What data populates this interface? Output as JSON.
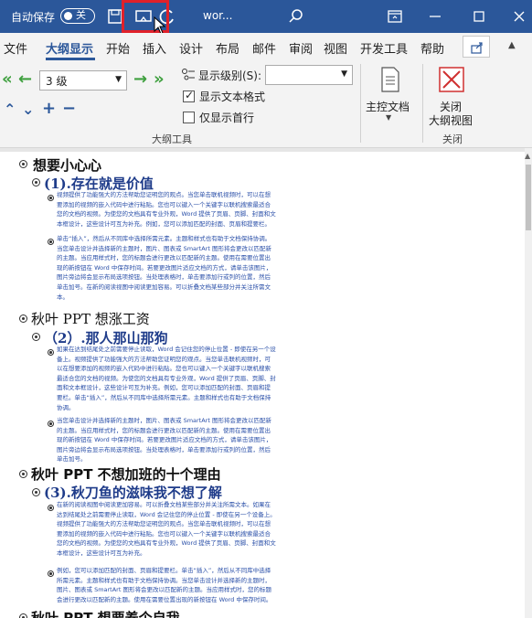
{
  "titlebar": {
    "autosave_label": "自动保存",
    "autosave_state": "关",
    "doc_title": "wor...",
    "icons": [
      "save-icon",
      "present-icon",
      "redo-icon",
      "search-icon",
      "ribbon-display-icon",
      "minimize-icon",
      "maximize-icon",
      "close-icon"
    ]
  },
  "tabs": [
    "文件",
    "大纲显示",
    "开始",
    "插入",
    "设计",
    "布局",
    "邮件",
    "审阅",
    "视图",
    "开发工具",
    "帮助"
  ],
  "active_tab": "大纲显示",
  "ribbon": {
    "level_value": "3 级",
    "show_level_label": "显示级别(S):",
    "show_level_value": "",
    "show_text_format_label": "显示文本格式",
    "show_text_format_checked": true,
    "first_line_only_label": "仅显示首行",
    "first_line_only_checked": false,
    "outline_tools_label": "大纲工具",
    "master_doc_label": "主控文档",
    "close_outline_label": "关闭\n大纲视图",
    "close_label": "关闭",
    "close_btn_line1": "关闭",
    "close_btn_line2": "大纲视图"
  },
  "document": {
    "h1_1": "想要小心心",
    "h2_1": "(1).存在就是价值",
    "p1": "视频提供了功能强大的方法帮助您证明您的观点。当您单击联机视频时，可以在想要添加的视频的嵌入代码中进行粘贴。您也可以键入一个关键字以联机搜索最适合您的文档的视频。为使您的文档具有专业外观，Word 提供了页眉、页脚、封面和文本框设计，这些设计可互为补充。例如，您可以添加匹配的封面、页眉和提要栏。",
    "p2": "单击“插入”，然后从不同库中选择所需元素。主题和样式也有助于文档保持协调。当您单击设计并选择新的主题时，图片、图表或 SmartArt 图形将会更改以匹配新的主题。当应用样式时，您的标题会进行更改以匹配新的主题。使用在需要位置出现的新按钮在 Word 中保存时间。若要更改图片适应文档的方式，请单击该图片，图片旁边将会显示布局选项按钮。当处理表格时，单击要添加行或列的位置，然后单击加号。在新的阅读视图中阅读更加容易。可以折叠文档某些部分并关注所需文本。",
    "h1_2": "秋叶 PPT 想涨工资",
    "h2_2": "（2）.那人那山那狗",
    "p3": "如果在达到结尾处之前需要停止读取，Word 会记住您的停止位置 - 即使在另一个设备上。视频提供了功能强大的方法帮助您证明您的观点。当您单击联机视频时，可以在想要添加的视频的嵌入代码中进行粘贴。您也可以键入一个关键字以联机搜索最适合您的文档的视频。为使您的文档具有专业外观，Word 提供了页眉、页脚、封面和文本框设计，这些设计可互为补充。例如，您可以添加匹配的封面、页眉和提要栏。单击“插入”，然后从不同库中选择所需元素。主题和样式也有助于文档保持协调。",
    "p4": "当您单击设计并选择新的主题时，图片、图表或 SmartArt 图形将会更改以匹配新的主题。当应用样式时，您的标题会进行更改以匹配新的主题。使用在需要位置出现的新按钮在 Word 中保存时间。若要更改图片适应文档的方式，请单击该图片，图片旁边将会显示布局选项按钮。当处理表格时，单击要添加行或列的位置，然后单击加号。",
    "h1_3": "秋叶 PPT 不想加班的十个理由",
    "h2_3": "(3).秋刀鱼的滋味我不想了解",
    "p5": "在新的阅读视图中阅读更加容易。可以折叠文档某些部分并关注所需文本。如果在达到结尾处之前需要停止读取，Word 会记住您的停止位置 - 即使在另一个设备上。视频提供了功能强大的方法帮助您证明您的观点。当您单击联机视频时，可以在想要添加的视频的嵌入代码中进行粘贴。您也可以键入一个关键字以联机搜索最适合您的文档的视频。为使您的文档具有专业外观，Word 提供了页眉、页脚、封面和文本框设计，这些设计可互为补充。",
    "p6": "例如，您可以添加匹配的封面、页眉和提要栏。单击“插入”，然后从不同库中选择所需元素。主题和样式也有助于文档保持协调。当您单击设计并选择新的主题时，图片、图表或 SmartArt 图形将会更改以匹配新的主题。当应用样式时，您的标题会进行更改以匹配新的主题。使用在需要位置出现的新按钮在 Word 中保存时间。",
    "h1_4": "秋叶 PPT 想要养个自我"
  },
  "colors": {
    "title_bar": "#2b579a",
    "accent": "#2b579a",
    "highlight_box": "#e0212a",
    "heading2": "#1f3c8a",
    "body_text": "#2a4fa8"
  }
}
